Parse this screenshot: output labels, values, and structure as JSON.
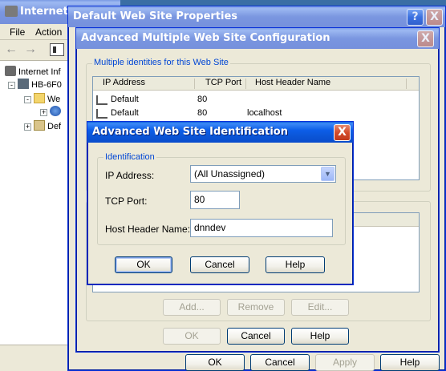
{
  "mmc": {
    "title": "Internet Inf",
    "menu": [
      "File",
      "Action"
    ],
    "tree": [
      "Internet Inf",
      "HB-6F0",
      "We",
      "Def"
    ]
  },
  "props": {
    "title": "Default Web Site Properties",
    "help_button": "?",
    "close_button": "X",
    "buttons": {
      "ok": "OK",
      "cancel": "Cancel",
      "apply": "Apply",
      "help": "Help"
    }
  },
  "adv": {
    "title": "Advanced Multiple Web Site Configuration",
    "close_button": "X",
    "group_label": "Multiple identities for this Web Site",
    "columns": [
      "IP Address",
      "TCP Port",
      "Host Header Name"
    ],
    "rows": [
      {
        "ip": "Default",
        "port": "80",
        "host": ""
      },
      {
        "ip": "Default",
        "port": "80",
        "host": "localhost"
      }
    ],
    "list_buttons": {
      "add": "Add...",
      "remove": "Remove",
      "edit": "Edit..."
    },
    "buttons": {
      "ok": "OK",
      "cancel": "Cancel",
      "help": "Help"
    }
  },
  "ident": {
    "title": "Advanced Web Site Identification",
    "close_button": "X",
    "group_label": "Identification",
    "ip_label": "IP Address:",
    "ip_value": "(All Unassigned)",
    "port_label": "TCP Port:",
    "port_value": "80",
    "host_label": "Host Header Name:",
    "host_value": "dnndev",
    "buttons": {
      "ok": "OK",
      "cancel": "Cancel",
      "help": "Help"
    }
  },
  "colors": {
    "title_active": "#0b55d6",
    "title_inactive": "#7a96e0",
    "dialog_face": "#ece9d8",
    "close_red": "#d44b2a",
    "group_label_blue": "#0046d5"
  }
}
